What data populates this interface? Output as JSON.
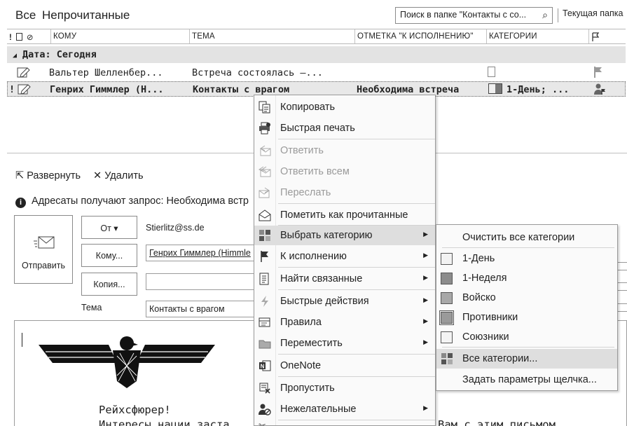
{
  "filter": {
    "tab_all": "Все",
    "tab_unread": "Непрочитанные",
    "search_placeholder": "Поиск в папке \"Контакты с со...",
    "scope": "Текущая папка"
  },
  "columns": {
    "to": "КОМУ",
    "subject": "ТЕМА",
    "followup": "ОТМЕТКА \"К ИСПОЛНЕНИЮ\"",
    "categories": "КАТЕГОРИИ"
  },
  "group": {
    "label": "Дата: Сегодня"
  },
  "messages": [
    {
      "to": "Вальтер Шелленбер...",
      "subject": "Встреча состоялась –...",
      "followup": "",
      "categories": ""
    },
    {
      "to": "Генрих Гиммлер (Н...",
      "subject": "Контакты с врагом",
      "followup": "Необходима встреча",
      "categories": "1-День; ..."
    }
  ],
  "compose": {
    "expand": "Развернуть",
    "delete": "Удалить",
    "info": "Адресаты получают запрос: Необходима встр",
    "send": "Отправить",
    "from_btn": "От ▾",
    "from_value": "Stierlitz@ss.de",
    "to_btn": "Кому...",
    "to_value": "Генрих Гиммлер (Himmle",
    "cc_btn": "Копия...",
    "cc_value": "",
    "subject_label": "Тема",
    "subject_value": "Контакты с врагом",
    "body_line1": "Рейхсфюрер!",
    "body_line2": "Интересы нации заста",
    "body_line2_right": "Вам с этим  письмом"
  },
  "context_menu": {
    "items": [
      {
        "label": "Копировать",
        "icon": "copy-icon",
        "enabled": true,
        "submenu": false
      },
      {
        "label": "Быстрая печать",
        "icon": "print-icon",
        "enabled": true,
        "submenu": false
      },
      {
        "label": "Ответить",
        "icon": "reply-icon",
        "enabled": false,
        "submenu": false
      },
      {
        "label": "Ответить всем",
        "icon": "reply-all-icon",
        "enabled": false,
        "submenu": false
      },
      {
        "label": "Переслать",
        "icon": "forward-icon",
        "enabled": false,
        "submenu": false
      },
      {
        "label": "Пометить как прочитанные",
        "icon": "envelope-open-icon",
        "enabled": true,
        "submenu": false
      },
      {
        "label": "Выбрать категорию",
        "icon": "categorize-icon",
        "enabled": true,
        "submenu": true
      },
      {
        "label": "К исполнению",
        "icon": "flag-icon",
        "enabled": true,
        "submenu": true
      },
      {
        "label": "Найти связанные",
        "icon": "find-related-icon",
        "enabled": true,
        "submenu": true
      },
      {
        "label": "Быстрые действия",
        "icon": "lightning-icon",
        "enabled": true,
        "submenu": true
      },
      {
        "label": "Правила",
        "icon": "rules-icon",
        "enabled": true,
        "submenu": true
      },
      {
        "label": "Переместить",
        "icon": "move-folder-icon",
        "enabled": true,
        "submenu": true
      },
      {
        "label": "OneNote",
        "icon": "onenote-icon",
        "enabled": true,
        "submenu": false
      },
      {
        "label": "Пропустить",
        "icon": "ignore-icon",
        "enabled": true,
        "submenu": false
      },
      {
        "label": "Нежелательные",
        "icon": "junk-icon",
        "enabled": true,
        "submenu": true
      }
    ]
  },
  "category_menu": {
    "clear_all": "Очистить все категории",
    "categories": [
      {
        "label": "1-День",
        "color": "#f2f2f2"
      },
      {
        "label": "1-Неделя",
        "color": "#8c8c8c"
      },
      {
        "label": "Войско",
        "color": "#a8a8a8"
      },
      {
        "label": "Противники",
        "color": "#9a9a9a"
      },
      {
        "label": "Союзники",
        "color": "#f4f4f4"
      }
    ],
    "all_categories": "Все категории...",
    "set_quick_click": "Задать параметры щелчка..."
  }
}
